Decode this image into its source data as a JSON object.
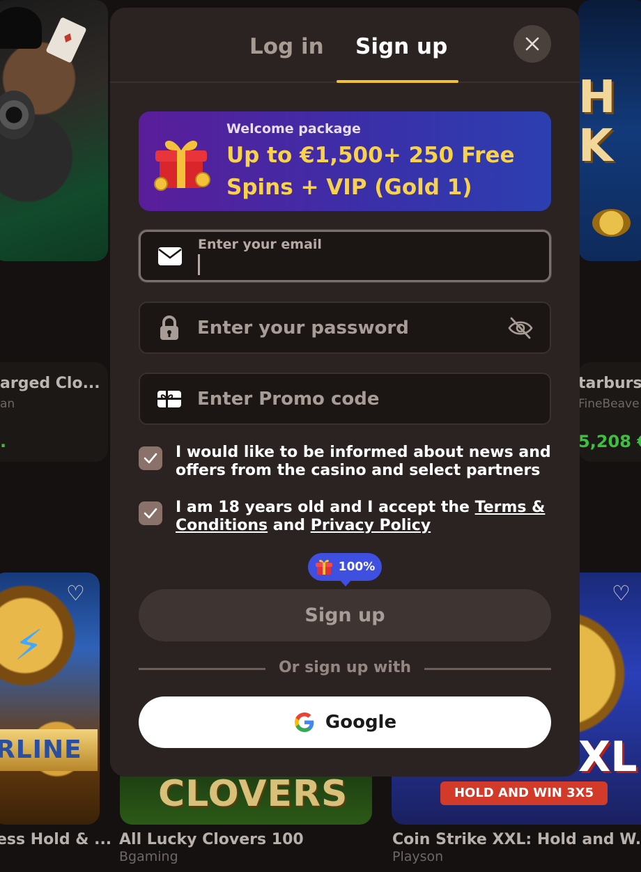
{
  "background": {
    "tile_right_top_letters": "H\nK",
    "info_left": {
      "title": "arged Clo...",
      "provider": "an",
      "amount": "."
    },
    "info_right": {
      "title": "tarburst",
      "provider": "FineBeave",
      "amount": "5,208 €"
    },
    "lightning_banner": "RLINE",
    "clovers_word": "CLOVERS",
    "coin_xxl": "XL",
    "coin_hold_banner": "HOLD AND WIN 3X5",
    "games": [
      {
        "name": "ess Hold & ...",
        "provider": ""
      },
      {
        "name": "All Lucky Clovers 100",
        "provider": "Bgaming"
      },
      {
        "name": "Coin Strike XXL: Hold and W...",
        "provider": "Playson"
      }
    ]
  },
  "modal": {
    "tabs": {
      "login": "Log in",
      "signup": "Sign up",
      "active": "signup"
    },
    "welcome": {
      "label": "Welcome package",
      "offer": "Up to €1,500+ 250 Free Spins + VIP (Gold 1)"
    },
    "email": {
      "label": "Enter your email",
      "value": ""
    },
    "password": {
      "placeholder": "Enter your password"
    },
    "promo": {
      "placeholder": "Enter Promo code"
    },
    "consent_news": {
      "checked": true,
      "text": "I would like to be informed about news and offers from the casino and select partners"
    },
    "consent_terms": {
      "checked": true,
      "prefix": "I am 18 years old and I accept the ",
      "terms_link": "Terms & Conditions",
      "middle": " and ",
      "privacy_link": "Privacy Policy"
    },
    "bonus_badge": "100%",
    "submit_label": "Sign up",
    "divider_text": "Or sign up with",
    "google_label": "Google"
  },
  "colors": {
    "accent_underline": "#f2c230",
    "offer_text": "#f8d24a",
    "bonus_badge": "#3f4fe0",
    "modal_bg": "#2b2321"
  },
  "icons": [
    "close-icon",
    "gift-icon",
    "envelope-icon",
    "lock-icon",
    "eye-off-icon",
    "promo-ticket-icon",
    "check-icon",
    "google-icon",
    "heart-icon"
  ]
}
